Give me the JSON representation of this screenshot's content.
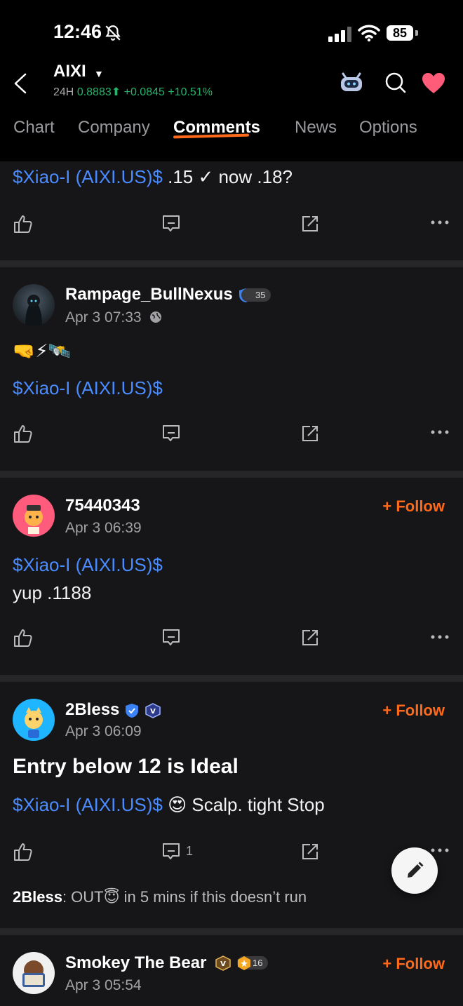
{
  "status_bar": {
    "time": "12:46",
    "battery": "85"
  },
  "header": {
    "ticker": "AIXI",
    "period_label": "24H",
    "price": "0.8883",
    "change": "+0.0845",
    "change_pct": "+10.51%"
  },
  "tabs": [
    {
      "label": "Chart"
    },
    {
      "label": "Company"
    },
    {
      "label": "Comments",
      "active": true
    },
    {
      "label": "News"
    },
    {
      "label": "Options"
    }
  ],
  "posts": [
    {
      "body_ticker": "$Xiao-I (AIXI.US)$",
      "body_suffix": ".15 ✓ now .18?"
    },
    {
      "user": "Rampage_BullNexus",
      "level": "35",
      "date": "Apr 3 07:33",
      "emoji_line": "🤜⚡🛰️",
      "body_ticker": "$Xiao-I (AIXI.US)$"
    },
    {
      "user": "75440343",
      "date": "Apr 3 06:39",
      "follow": "+ Follow",
      "body_ticker": "$Xiao-I (AIXI.US)$",
      "body_line2": "yup .1188"
    },
    {
      "user": "2Bless",
      "date": "Apr 3 06:09",
      "follow": "+ Follow",
      "title": "Entry below 12 is Ideal",
      "body_ticker": "$Xiao-I (AIXI.US)$",
      "body_suffix": "😍 Scalp. tight Stop",
      "comment_count": "1",
      "reply_user": "2Bless",
      "reply_text": ": OUT😇 in 5 mins if this doesn’t run"
    },
    {
      "user": "Smokey The Bear",
      "level": "16",
      "date": "Apr 3 05:54",
      "follow": "+ Follow"
    }
  ],
  "colors": {
    "accent": "#ff6a1a",
    "ticker_link": "#4a8cff",
    "up": "#26b36b",
    "heart": "#ff5c7a"
  },
  "icons": [
    "back-icon",
    "chevron-down-icon",
    "robot-icon",
    "search-icon",
    "heart-icon",
    "like-icon",
    "comment-icon",
    "share-icon",
    "more-icon",
    "edit-icon"
  ]
}
